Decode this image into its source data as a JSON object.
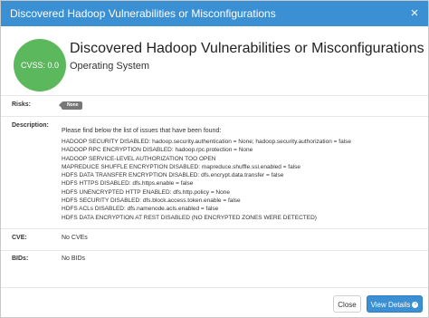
{
  "window": {
    "title": "Discovered Hadoop Vulnerabilities or Misconfigurations",
    "close_glyph": "×"
  },
  "summary": {
    "cvss_label": "CVSS: 0.0",
    "cvss_color": "#5cb85c",
    "heading": "Discovered Hadoop Vulnerabilities or Misconfigurations",
    "subheading": "Operating System"
  },
  "details": {
    "risks_label": "Risks:",
    "risk_badge": "None",
    "description_label": "Description:",
    "description_intro": "Please find below the list of issues that have been found:",
    "issues": [
      "HADOOP SECURITY DISABLED: hadoop.security.authentication = None; hadoop.security.authorization = false",
      "HADOOP RPC ENCRYPTION DISABLED: hadoop.rpc.protection = None",
      "HADOOP SERVICE-LEVEL AUTHORIZATION TOO OPEN",
      "MAPREDUCE SHUFFLE ENCRYPTION DISABLED: mapreduce.shuffle.ssl.enabled = false",
      "HDFS DATA TRANSFER ENCRYPTION DISABLED: dfs.encrypt.data.transfer = false",
      "HDFS HTTPS DISABLED: dfs.https.enable = false",
      "HDFS UNENCRYPTED HTTP ENABLED: dfs.http.policy = None",
      "HDFS SECURITY DISABLED: dfs.block.access.token.enable = false",
      "HDFS ACLs DISABLED: dfs.namenode.acls.enabled = false",
      "HDFS DATA ENCRYPTION AT REST DISABLED (NO ENCRYPTED ZONES WERE DETECTED)"
    ],
    "cve_label": "CVE:",
    "cve_value": "No CVEs",
    "bid_label": "BIDs:",
    "bid_value": "No BIDs"
  },
  "footer": {
    "close_label": "Close",
    "view_details_label": "View Details",
    "view_details_icon": "arrow-right-circle-icon"
  },
  "colors": {
    "accent": "#3b8fd3",
    "cvss_green": "#5cb85c",
    "badge_gray": "#777777"
  }
}
